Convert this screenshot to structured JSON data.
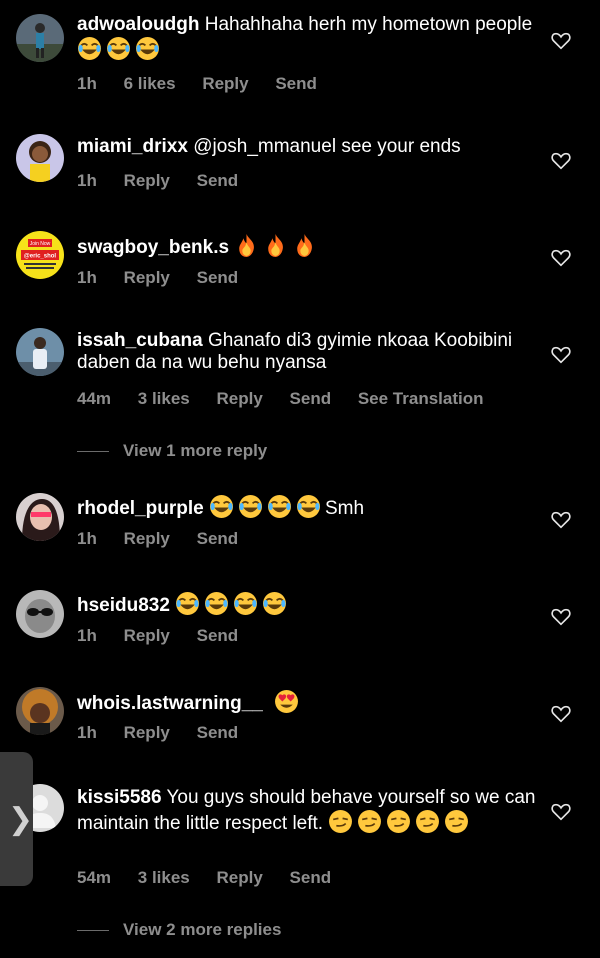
{
  "comments": [
    {
      "username": "adwoaloudgh",
      "text": "Hahahhaha herh my hometown people",
      "emojis": [
        "joy",
        "joy",
        "joy"
      ],
      "time": "1h",
      "likes": "6 likes",
      "reply": "Reply",
      "send": "Send",
      "avatar": "avatar-person-standing"
    },
    {
      "username": "miami_drixx",
      "text": "@josh_mmanuel  see your ends",
      "emojis": [],
      "time": "1h",
      "likes": "",
      "reply": "Reply",
      "send": "Send",
      "avatar": "avatar-cartoon"
    },
    {
      "username": "swagboy_benk.s",
      "text": "",
      "emojis": [
        "fire",
        "fire",
        "fire"
      ],
      "time": "1h",
      "likes": "",
      "reply": "Reply",
      "send": "Send",
      "avatar": "avatar-yellow-badge",
      "avatar_text_top": "Join Now",
      "avatar_text_mid": "@eric_shol"
    },
    {
      "username": "issah_cubana",
      "text": "Ghanafo di3 gyimie nkoaa Koobibini daben da na wu behu nyansa",
      "emojis": [],
      "time": "44m",
      "likes": "3 likes",
      "reply": "Reply",
      "send": "Send",
      "translate": "See Translation",
      "avatar": "avatar-person-light"
    },
    {
      "username": "rhodel_purple",
      "text": "Smh",
      "emojis": [
        "joy",
        "joy",
        "joy",
        "joy"
      ],
      "emojis_before_text": true,
      "time": "1h",
      "likes": "",
      "reply": "Reply",
      "send": "Send",
      "avatar": "avatar-woman"
    },
    {
      "username": "hseidu832",
      "text": "",
      "emojis": [
        "joy",
        "joy",
        "joy",
        "joy"
      ],
      "time": "1h",
      "likes": "",
      "reply": "Reply",
      "send": "Send",
      "avatar": "avatar-sunglasses"
    },
    {
      "username": "whois.lastwarning__",
      "text": "",
      "emojis": [
        "heart-eyes"
      ],
      "time": "1h",
      "likes": "",
      "reply": "Reply",
      "send": "Send",
      "avatar": "avatar-curly-hair"
    },
    {
      "username": "kissi5586",
      "text": "You guys should behave yourself so we can maintain the little respect left.",
      "emojis": [
        "smirk",
        "smirk",
        "smirk",
        "smirk",
        "smirk"
      ],
      "time": "54m",
      "likes": "3 likes",
      "reply": "Reply",
      "send": "Send",
      "avatar": "avatar-default"
    }
  ],
  "view_more": [
    "View 1 more reply",
    "View 2 more replies"
  ],
  "colors": {
    "background": "#000000",
    "text": "#ffffff",
    "muted": "#8e8e8e",
    "emoji_yellow": "#ffc83d"
  },
  "side_tab_icon": "chevron-right-icon"
}
